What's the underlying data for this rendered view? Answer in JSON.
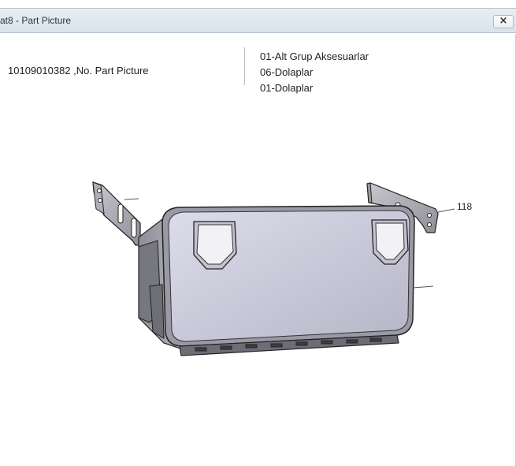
{
  "window": {
    "title": "at8 - Part Picture",
    "close_label": "×"
  },
  "part": {
    "label": "10109010382 ,No. Part Picture"
  },
  "groups": [
    "01-Alt Grup Aksesuarlar",
    "06-Dolaplar",
    "01-Dolaplar"
  ],
  "drawing": {
    "callout": "118",
    "icon": "storage-box-drawing"
  }
}
